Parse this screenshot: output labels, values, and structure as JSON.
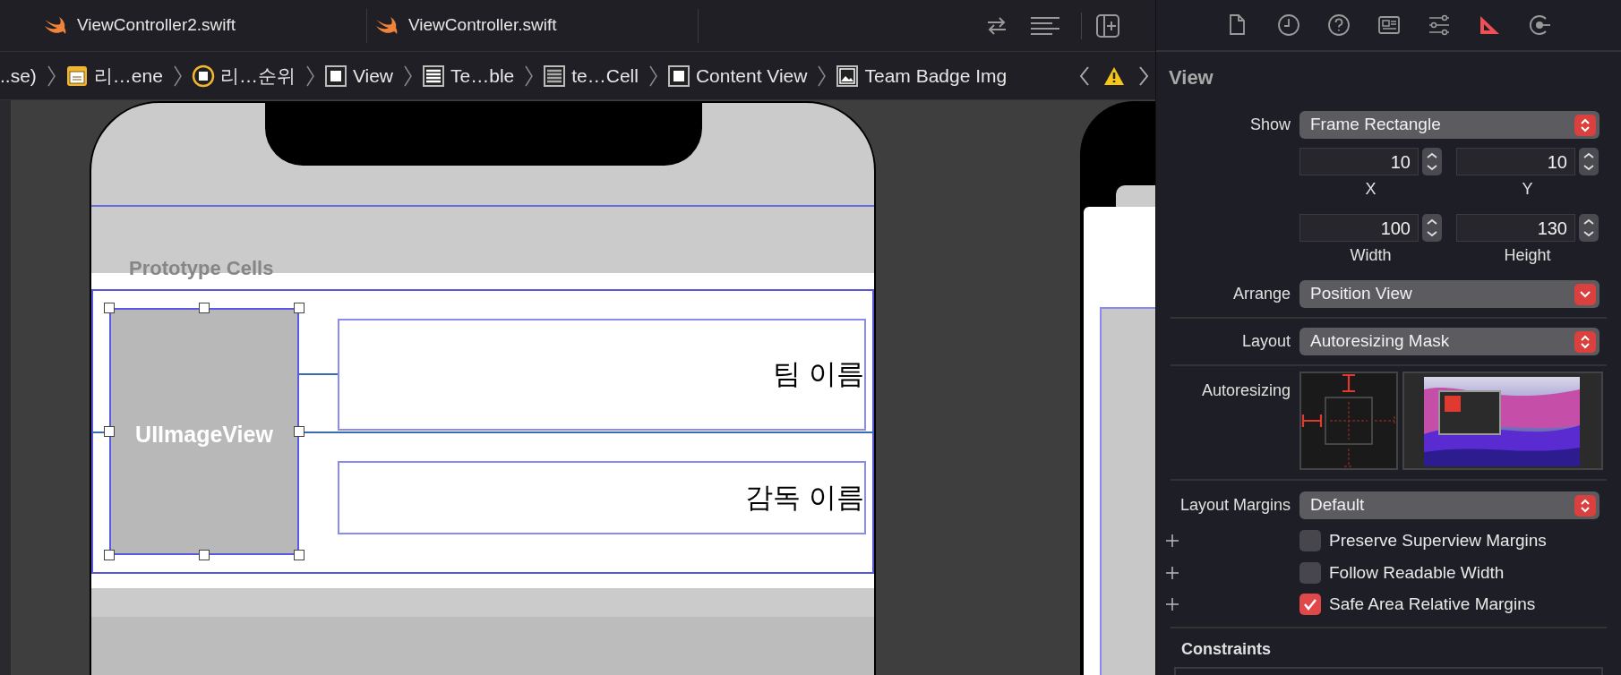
{
  "editor_tabs": [
    {
      "label": "ViewController2.swift"
    },
    {
      "label": "ViewController.swift"
    }
  ],
  "breadcrumb": [
    {
      "kind": "text",
      "label": "..se)"
    },
    {
      "kind": "scene",
      "label": "리…ene"
    },
    {
      "kind": "controller",
      "label": "리…순위"
    },
    {
      "kind": "view",
      "label": "View"
    },
    {
      "kind": "table",
      "label": "Te…ble"
    },
    {
      "kind": "cell",
      "label": "te…Cell"
    },
    {
      "kind": "view",
      "label": "Content View"
    },
    {
      "kind": "image",
      "label": "Team Badge Img"
    }
  ],
  "canvas": {
    "section_header": "Prototype Cells",
    "image_view_label": "UIImageView",
    "labels": [
      "팀 이름",
      "감독 이름"
    ]
  },
  "inspector": {
    "tabs": [
      {
        "kind": "file",
        "selected": false
      },
      {
        "kind": "history",
        "selected": false
      },
      {
        "kind": "help",
        "selected": false
      },
      {
        "kind": "identity",
        "selected": false
      },
      {
        "kind": "attributes",
        "selected": false
      },
      {
        "kind": "size",
        "selected": true
      },
      {
        "kind": "connections",
        "selected": false
      }
    ],
    "title": "View",
    "show": {
      "label": "Show",
      "value": "Frame Rectangle"
    },
    "fields": [
      {
        "label": "X",
        "value": "10"
      },
      {
        "label": "Y",
        "value": "10"
      },
      {
        "label": "Width",
        "value": "100"
      },
      {
        "label": "Height",
        "value": "130"
      }
    ],
    "arrange": {
      "label": "Arrange",
      "value": "Position View"
    },
    "layout": {
      "label": "Layout",
      "value": "Autoresizing Mask"
    },
    "autoresizing": {
      "label": "Autoresizing"
    },
    "layout_margins": {
      "label": "Layout Margins",
      "value": "Default"
    },
    "checkboxes": [
      {
        "label": "Preserve Superview Margins",
        "checked": false
      },
      {
        "label": "Follow Readable Width",
        "checked": false
      },
      {
        "label": "Safe Area Relative Margins",
        "checked": true
      }
    ],
    "constraints": {
      "title": "Constraints"
    }
  }
}
